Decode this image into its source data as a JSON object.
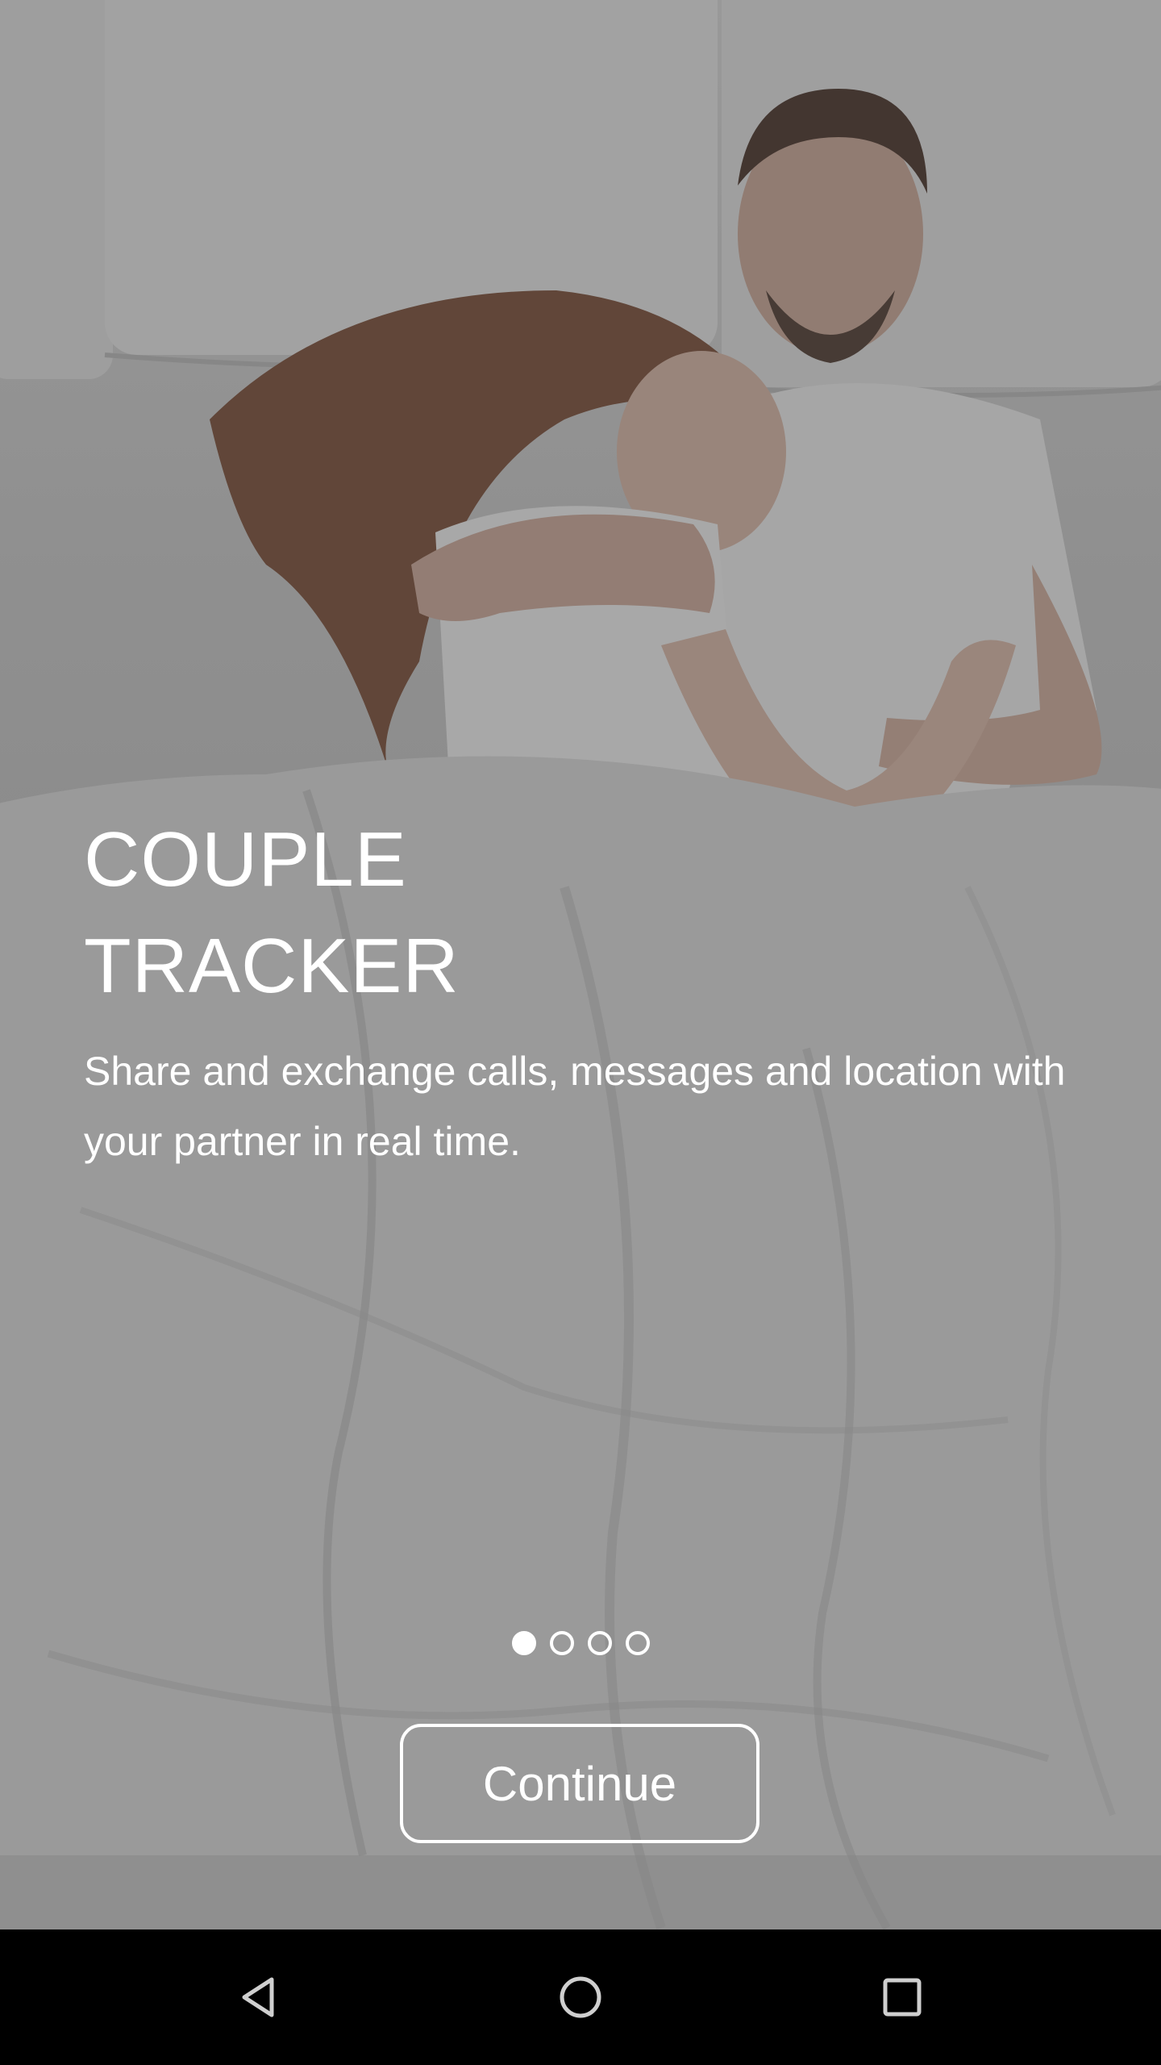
{
  "onboarding": {
    "title_line1": "COUPLE",
    "title_line2": "TRACKER",
    "description": "Share and exchange calls, messages and location with your partner in real time.",
    "pager": {
      "total": 4,
      "active_index": 0
    },
    "continue_label": "Continue"
  },
  "background_image": {
    "icon": "couple-sleeping-photo"
  },
  "nav_bar": {
    "back_icon": "back-triangle-icon",
    "home_icon": "home-circle-icon",
    "recents_icon": "recents-square-icon"
  },
  "colors": {
    "text": "#ffffff",
    "nav_bar_bg": "#000000",
    "nav_icon": "#cfcfcf"
  }
}
